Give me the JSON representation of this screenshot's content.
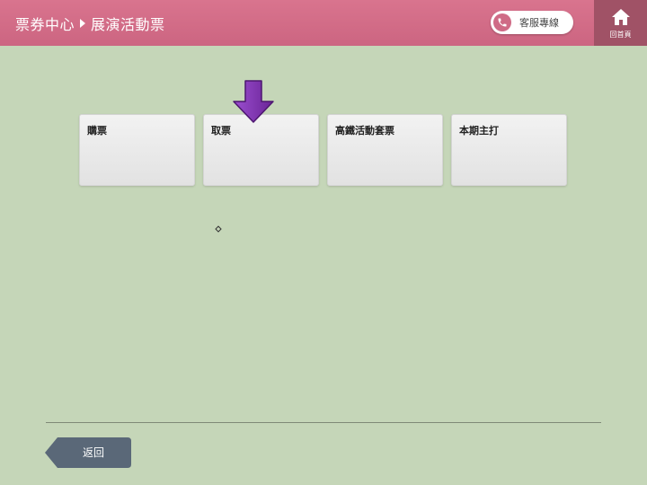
{
  "header": {
    "breadcrumb": [
      "票券中心",
      "展演活動票"
    ],
    "service_label": "客服專線",
    "home_label": "回首頁"
  },
  "tiles": [
    {
      "label": "購票"
    },
    {
      "label": "取票"
    },
    {
      "label": "高鐵活動套票"
    },
    {
      "label": "本期主打"
    }
  ],
  "footer": {
    "back_label": "返回"
  },
  "colors": {
    "header_bg": "#d16d88",
    "home_bg": "#a05266",
    "page_bg": "#c5d6b8",
    "arrow": "#7a2fb0",
    "back_btn": "#5a6878"
  },
  "icons": {
    "phone": "phone-icon",
    "home": "home-icon",
    "arrow": "arrow-down-icon",
    "back": "back-arrow-icon"
  }
}
